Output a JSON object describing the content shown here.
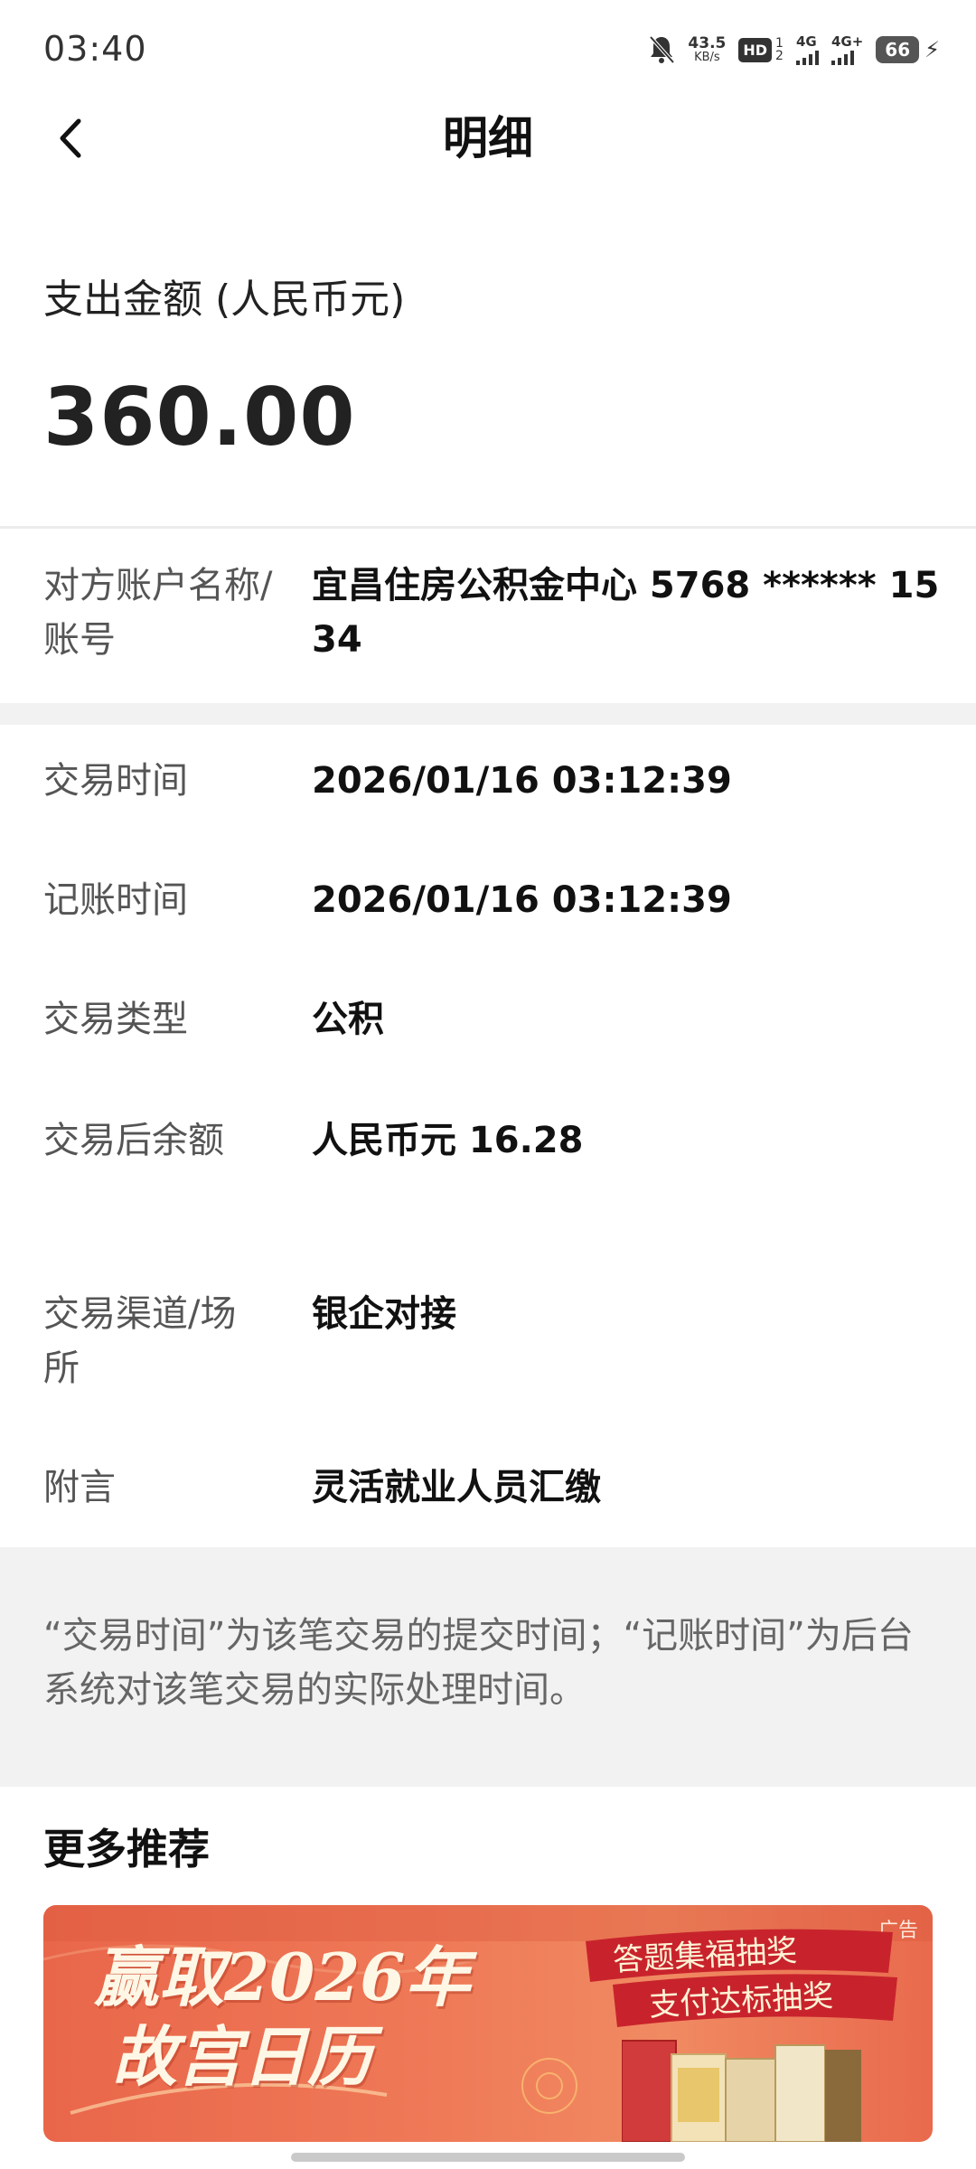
{
  "status_bar": {
    "time": "03:40",
    "net_speed_value": "43.5",
    "net_speed_unit": "KB/s",
    "hd": "HD",
    "hd_sub_top": "1",
    "hd_sub_bottom": "2",
    "sig1_label": "4G",
    "sig2_label": "4G+",
    "battery": "66",
    "icons": [
      "mute-bell-icon",
      "signal-icon",
      "charging-bolt-icon"
    ]
  },
  "nav": {
    "title": "明细",
    "back_icon": "chevron-left-icon"
  },
  "amount": {
    "label": "支出金额 (人民币元)",
    "value": "360.00"
  },
  "details": [
    {
      "label": "对方账户名称/账号",
      "value": "宜昌住房公积金中心 5768 ****** 1534"
    },
    {
      "label": "交易时间",
      "value": "2026/01/16 03:12:39"
    },
    {
      "label": "记账时间",
      "value": "2026/01/16 03:12:39"
    },
    {
      "label": "交易类型",
      "value": "公积"
    },
    {
      "label": "交易后余额",
      "value": "人民币元 16.28"
    },
    {
      "label": "交易渠道/场所",
      "value": "银企对接"
    },
    {
      "label": "附言",
      "value": "灵活就业人员汇缴"
    }
  ],
  "note": "“交易时间”为该笔交易的提交时间；“记账时间”为后台系统对该笔交易的实际处理时间。",
  "more": {
    "title": "更多推荐",
    "banner": {
      "ad_tag": "广告",
      "headline_line1": "赢取2026年",
      "headline_line2": "故宫日历",
      "ribbon_line1": "答题集福抽奖",
      "ribbon_line2": "支付达标抽奖"
    }
  },
  "colors": {
    "banner_red": "#e9664a",
    "band_grey": "#f2f2f2"
  }
}
